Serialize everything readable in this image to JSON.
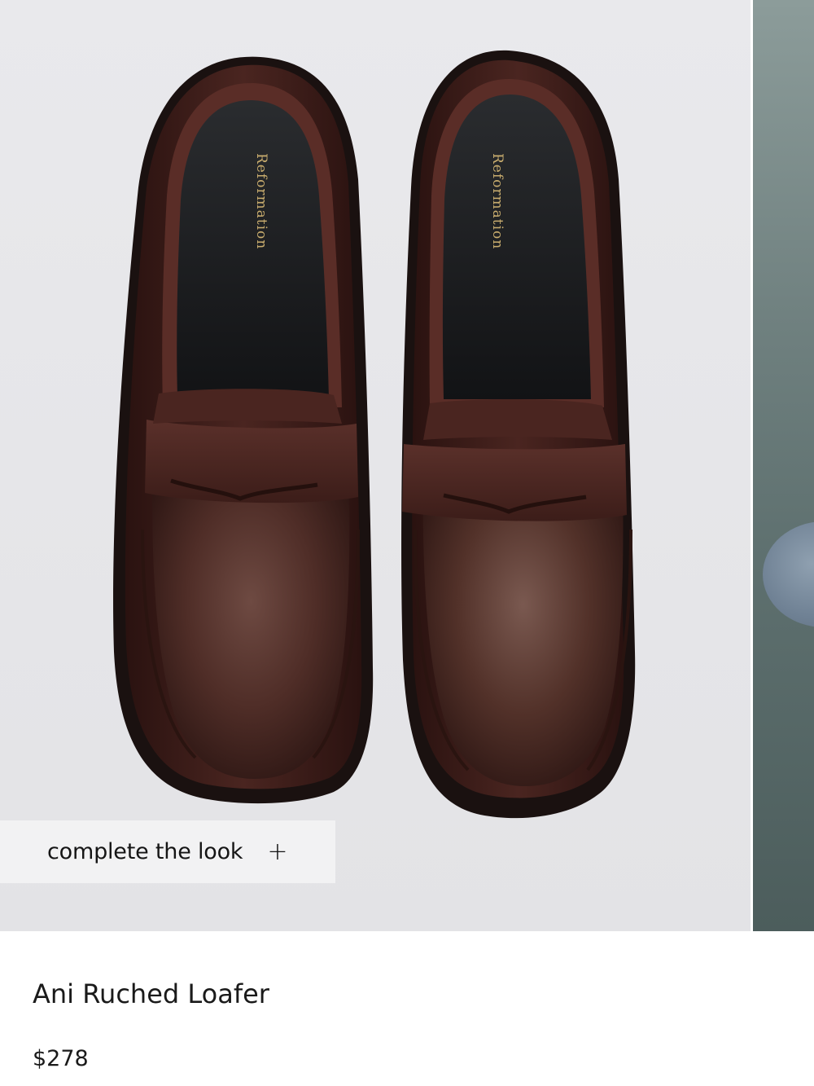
{
  "gallery": {
    "main_image": {
      "alt": "Brown leather penny loafers, top view",
      "insole_brand": "Reformation"
    },
    "next_image": {
      "alt": "Next product photo"
    }
  },
  "complete_the_look": {
    "label": "complete the look",
    "icon": "plus-icon",
    "icon_glyph": "+"
  },
  "product": {
    "name": "Ani Ruched Loafer",
    "price": "$278"
  },
  "colors": {
    "photo_background": "#e7e7ea",
    "leather": "#3f1f1b",
    "insole": "#1a1b1d",
    "brand_gold": "#c9ad6e",
    "button_background": "#f2f2f3"
  }
}
